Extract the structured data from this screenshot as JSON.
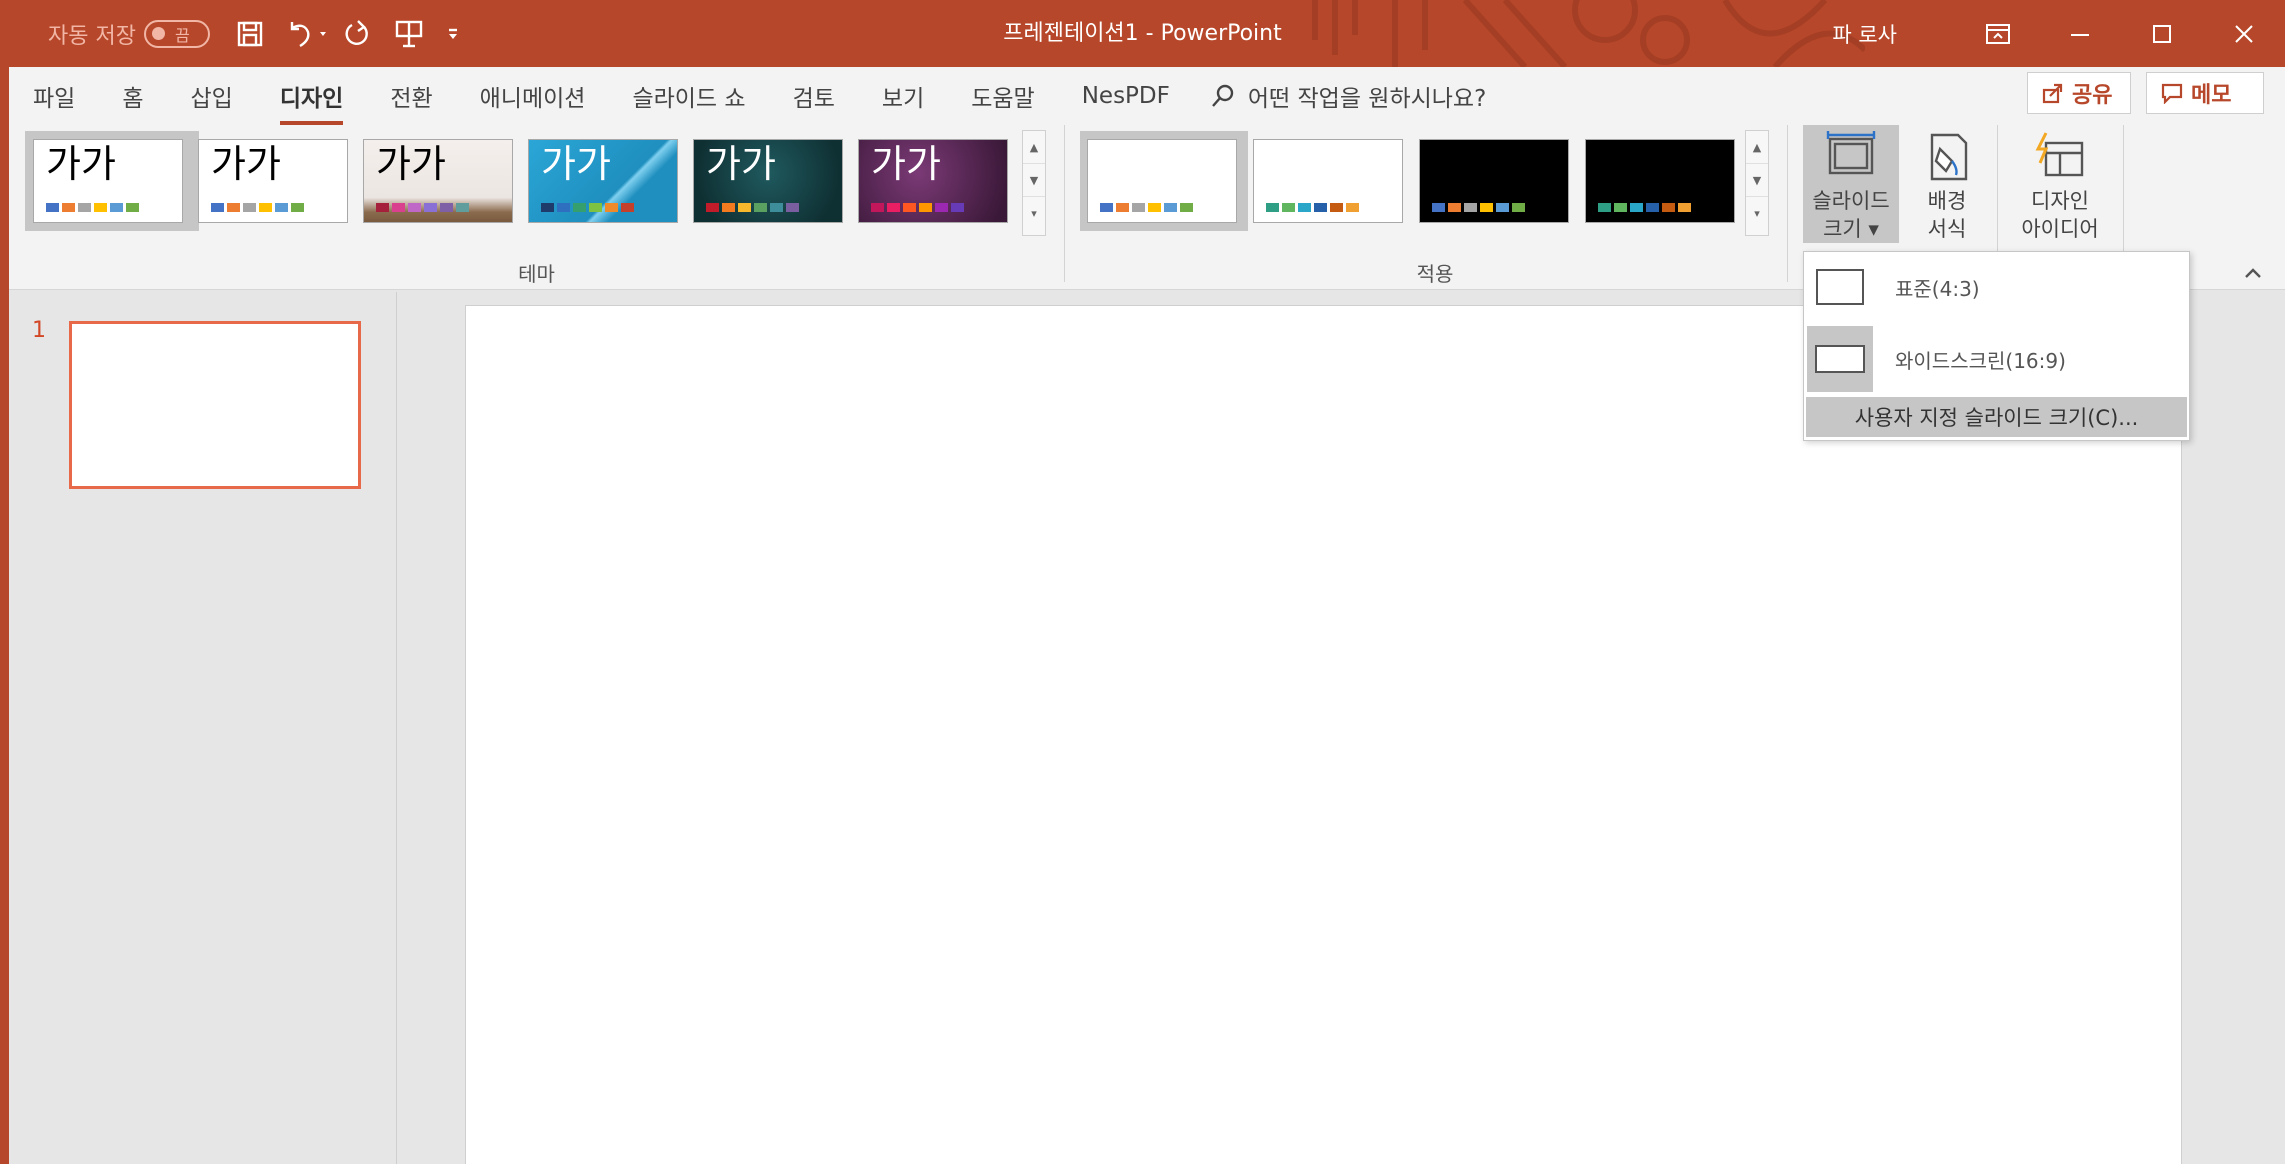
{
  "titlebar": {
    "autosave_label": "자동 저장",
    "autosave_state": "끔",
    "title": "프레젠테이션1 - PowerPoint",
    "user": "파 로사",
    "icons": [
      "save-icon",
      "undo-icon",
      "redo-icon",
      "start-slideshow-icon",
      "customize-qat-icon",
      "ribbon-display-icon",
      "minimize-icon",
      "maximize-icon",
      "close-icon"
    ]
  },
  "menu": {
    "tabs": [
      "파일",
      "홈",
      "삽입",
      "디자인",
      "전환",
      "애니메이션",
      "슬라이드 쇼",
      "검토",
      "보기",
      "도움말",
      "NesPDF"
    ],
    "active_tab": "디자인",
    "tell_me": "어떤 작업을 원하시나요?",
    "share": "공유",
    "memo": "메모"
  },
  "ribbon": {
    "themes_label": "테마",
    "themes_glyph": "가가",
    "themes": [
      {
        "bg": "#ffffff",
        "text": "#000000",
        "swatches": [
          "#4472c4",
          "#ed7d31",
          "#a5a5a5",
          "#ffc000",
          "#5b9bd5",
          "#70ad47"
        ]
      },
      {
        "bg": "#ffffff",
        "text": "#000000",
        "swatches": [
          "#4472c4",
          "#ed7d31",
          "#a5a5a5",
          "#ffc000",
          "#5b9bd5",
          "#70ad47"
        ]
      },
      {
        "bg": "#ece6e2",
        "text": "#000000",
        "swatches": [
          "#a5203a",
          "#d9418f",
          "#bf68c8",
          "#8a6fd5",
          "#7f5fa5",
          "#5f9e9d"
        ]
      },
      {
        "bg": "#1f8fbf",
        "text": "#ffffff",
        "swatches": [
          "#1f3b6b",
          "#2f6fbf",
          "#35a06d",
          "#7fc241",
          "#ef8a2b",
          "#c4402b"
        ]
      },
      {
        "bg": "#123b3f",
        "text": "#ffffff",
        "swatches": [
          "#c21b2a",
          "#f47a20",
          "#f7b82b",
          "#5aa061",
          "#3d8d9a",
          "#7a5fa0"
        ]
      },
      {
        "bg": "#5c2a58",
        "text": "#ffffff",
        "swatches": [
          "#c2185b",
          "#e91e63",
          "#ff5722",
          "#ff9800",
          "#9c27b0",
          "#673ab7"
        ]
      }
    ],
    "variants_label": "적용",
    "variants": [
      {
        "bg": "#ffffff",
        "swatches": [
          "#4472c4",
          "#ed7d31",
          "#a5a5a5",
          "#ffc000",
          "#5b9bd5",
          "#70ad47"
        ]
      },
      {
        "bg": "#ffffff",
        "swatches": [
          "#2e9e84",
          "#5fb65f",
          "#2aa6c9",
          "#2560a8",
          "#c55a11",
          "#f0a030"
        ]
      },
      {
        "bg": "#000000",
        "swatches": [
          "#4472c4",
          "#ed7d31",
          "#a5a5a5",
          "#ffc000",
          "#5b9bd5",
          "#70ad47"
        ]
      },
      {
        "bg": "#000000",
        "swatches": [
          "#2e9e84",
          "#5fb65f",
          "#2aa6c9",
          "#2560a8",
          "#c55a11",
          "#f0a030"
        ]
      }
    ],
    "slide_size_line1": "슬라이드",
    "slide_size_line2": "크기 ▾",
    "format_bg_line1": "배경",
    "format_bg_line2": "서식",
    "design_ideas_line1": "디자인",
    "design_ideas_line2": "아이디어"
  },
  "dropdown": {
    "standard": "표준(4:3)",
    "widescreen": "와이드스크린(16:9)",
    "custom": "사용자 지정 슬라이드 크기(C)..."
  },
  "slides": {
    "number": "1"
  },
  "colors": {
    "accent": "#b7472a",
    "selection": "#e8694a"
  }
}
